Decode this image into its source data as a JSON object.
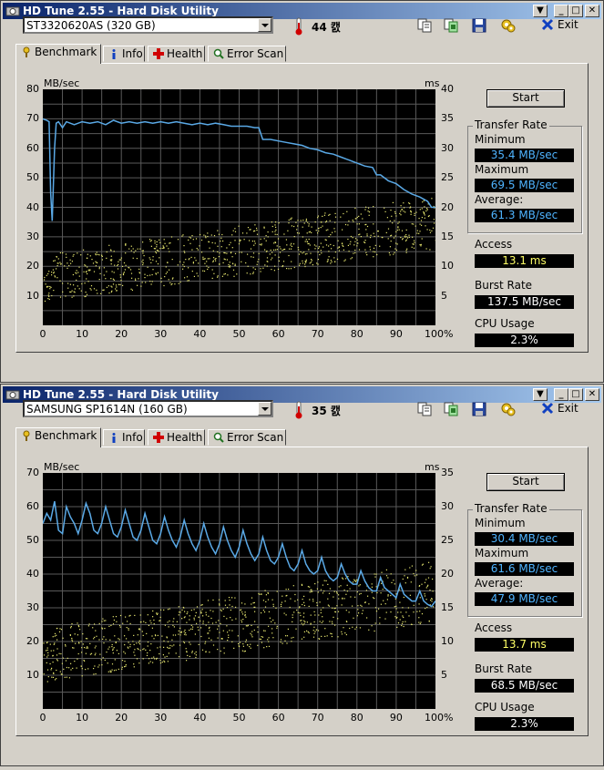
{
  "windows": [
    {
      "title": "HD Tune 2.55 - Hard Disk Utility",
      "drive": "ST3320620AS (320 GB)",
      "temperature": "44 캜",
      "exit_label": "Exit",
      "tabs": [
        "Benchmark",
        "Info",
        "Health",
        "Error Scan"
      ],
      "start_label": "Start",
      "transfer_rate_title": "Transfer Rate",
      "minimum_label": "Minimum",
      "minimum": "35.4 MB/sec",
      "maximum_label": "Maximum",
      "maximum": "69.5 MB/sec",
      "average_label": "Average:",
      "average": "61.3 MB/sec",
      "access_label": "Access",
      "access": "13.1 ms",
      "burst_label": "Burst Rate",
      "burst": "137.5 MB/sec",
      "cpu_label": "CPU Usage",
      "cpu": "2.3%",
      "chart_data": {
        "type": "line",
        "ylabel_left": "MB/sec",
        "ylabel_right": "ms",
        "xlim": [
          0,
          100
        ],
        "ylim_left": [
          0,
          80
        ],
        "ylim_right": [
          0,
          40
        ],
        "x_ticks": [
          "0",
          "10",
          "20",
          "30",
          "40",
          "50",
          "60",
          "70",
          "80",
          "90",
          "100%"
        ],
        "y_ticks_left": [
          "80",
          "70",
          "60",
          "50",
          "40",
          "30",
          "20",
          "10"
        ],
        "y_ticks_right": [
          "40",
          "35",
          "30",
          "25",
          "20",
          "15",
          "10",
          "5"
        ],
        "grid": true,
        "transfer_color": "#5aa9e6",
        "access_color": "#e8e870",
        "series": [
          {
            "x": [
              0,
              1,
              1.6,
              2,
              2.4,
              3,
              3.4,
              4,
              5,
              6,
              8,
              10,
              12,
              14,
              16,
              18,
              20,
              22,
              24,
              26,
              28,
              30,
              32,
              34,
              36,
              38,
              40,
              42,
              44,
              46,
              48,
              50,
              52,
              54,
              55,
              56,
              58,
              60,
              62,
              64,
              66,
              68,
              70,
              72,
              74,
              76,
              78,
              80,
              82,
              84,
              85,
              86,
              88,
              90,
              92,
              94,
              96,
              98,
              99,
              100
            ],
            "values": [
              70,
              69.5,
              69,
              45,
              35.4,
              60,
              68.5,
              69,
              67,
              69,
              68,
              69,
              68.5,
              69,
              68,
              69.5,
              68.5,
              69,
              68.5,
              69,
              68.5,
              69,
              68.5,
              69,
              68.5,
              68,
              68.5,
              68,
              68.5,
              68,
              67.5,
              67.5,
              67.5,
              67,
              67,
              63,
              63,
              62.5,
              62,
              61.5,
              61,
              60,
              59.5,
              58.5,
              58,
              57,
              56,
              55,
              54,
              53.5,
              51,
              51,
              49,
              48,
              46,
              44.5,
              43.5,
              42,
              40,
              40
            ]
          },
          {
            "description": "access_scatter",
            "x_range": [
              0,
              100
            ],
            "values_ms_range": [
              3,
              22
            ]
          }
        ]
      }
    },
    {
      "title": "HD Tune 2.55 - Hard Disk Utility",
      "drive": "SAMSUNG SP1614N (160 GB)",
      "temperature": "35 캜",
      "exit_label": "Exit",
      "tabs": [
        "Benchmark",
        "Info",
        "Health",
        "Error Scan"
      ],
      "start_label": "Start",
      "transfer_rate_title": "Transfer Rate",
      "minimum_label": "Minimum",
      "minimum": "30.4 MB/sec",
      "maximum_label": "Maximum",
      "maximum": "61.6 MB/sec",
      "average_label": "Average:",
      "average": "47.9 MB/sec",
      "access_label": "Access",
      "access": "13.7 ms",
      "burst_label": "Burst Rate",
      "burst": "68.5 MB/sec",
      "cpu_label": "CPU Usage",
      "cpu": "2.3%",
      "chart_data": {
        "type": "line",
        "ylabel_left": "MB/sec",
        "ylabel_right": "ms",
        "xlim": [
          0,
          100
        ],
        "ylim_left": [
          0,
          70
        ],
        "ylim_right": [
          0,
          35
        ],
        "x_ticks": [
          "0",
          "10",
          "20",
          "30",
          "40",
          "50",
          "60",
          "70",
          "80",
          "90",
          "100%"
        ],
        "y_ticks_left": [
          "70",
          "60",
          "50",
          "40",
          "30",
          "20",
          "10"
        ],
        "y_ticks_right": [
          "35",
          "30",
          "25",
          "20",
          "15",
          "10",
          "5"
        ],
        "grid": true,
        "transfer_color": "#5aa9e6",
        "access_color": "#e8e870",
        "series": [
          {
            "x": [
              0,
              1,
              2,
              3,
              4,
              5,
              6,
              7,
              8,
              9,
              10,
              11,
              12,
              13,
              14,
              15,
              16,
              17,
              18,
              19,
              20,
              21,
              22,
              23,
              24,
              25,
              26,
              27,
              28,
              29,
              30,
              31,
              32,
              33,
              34,
              35,
              36,
              37,
              38,
              39,
              40,
              41,
              42,
              43,
              44,
              45,
              46,
              47,
              48,
              49,
              50,
              51,
              52,
              53,
              54,
              55,
              56,
              57,
              58,
              59,
              60,
              61,
              62,
              63,
              64,
              65,
              66,
              67,
              68,
              69,
              70,
              71,
              72,
              73,
              74,
              75,
              76,
              77,
              78,
              79,
              80,
              81,
              82,
              83,
              84,
              85,
              86,
              87,
              88,
              89,
              90,
              91,
              92,
              93,
              94,
              95,
              96,
              97,
              98,
              99,
              100
            ],
            "values": [
              55,
              58,
              56,
              61.6,
              53,
              52,
              60,
              57,
              55,
              52,
              56,
              61,
              58,
              53,
              52,
              55,
              60,
              56,
              52,
              51,
              54,
              59,
              55,
              51,
              50,
              53,
              58,
              54,
              50,
              49,
              52,
              57,
              53,
              50,
              48,
              51,
              56,
              52,
              49,
              47,
              50,
              55,
              51,
              48,
              46,
              49,
              54,
              50,
              47,
              45,
              48,
              53,
              49,
              46,
              44,
              46,
              51,
              47,
              44,
              43,
              45,
              49,
              45,
              42,
              41,
              43,
              47,
              43,
              41,
              40,
              41,
              45,
              41,
              39,
              38,
              39,
              43,
              40,
              38,
              37,
              37,
              41,
              38,
              36,
              35,
              35,
              39,
              36,
              35,
              34,
              33,
              37,
              34,
              33,
              32,
              32,
              35,
              32,
              31,
              30.4,
              32
            ]
          },
          {
            "description": "access_scatter",
            "x_range": [
              0,
              100
            ],
            "values_ms_range": [
              3,
              22
            ]
          }
        ]
      }
    }
  ]
}
